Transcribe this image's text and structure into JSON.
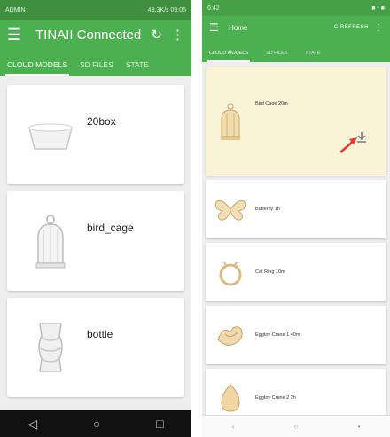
{
  "left": {
    "status": {
      "left_text": "ADMIN",
      "right_text": "43.3K/s 09:05"
    },
    "header": {
      "title": "TINAII Connected"
    },
    "tabs": [
      "CLOUD MODELS",
      "SD FILES",
      "STATE"
    ],
    "models": [
      {
        "name": "20box",
        "icon": "box-model-icon"
      },
      {
        "name": "bird_cage",
        "icon": "bird-cage-model-icon"
      },
      {
        "name": "bottle",
        "icon": "bottle-model-icon"
      }
    ]
  },
  "right": {
    "status": {
      "left_text": "6:42",
      "right_text": "■ • ■"
    },
    "header": {
      "title": "Home",
      "refresh_label": "C REFRESH"
    },
    "tabs": [
      "CLOUD MODELS",
      "SD FILES",
      "STATE"
    ],
    "models": [
      {
        "name": "Bird Cage 20m",
        "icon": "bird-cage-model-icon"
      },
      {
        "name": "Butterfly 1h",
        "icon": "butterfly-model-icon"
      },
      {
        "name": "Cat Ring 10m",
        "icon": "cat-ring-model-icon"
      },
      {
        "name": "Eggtoy Crane 1 40m",
        "icon": "crane-model-icon"
      },
      {
        "name": "Eggtoy Crane 2 2h",
        "icon": "egg-model-icon"
      }
    ]
  },
  "colors": {
    "primary": "#4caf50",
    "highlight": "#fbf3d7",
    "arrow": "#e53935"
  }
}
